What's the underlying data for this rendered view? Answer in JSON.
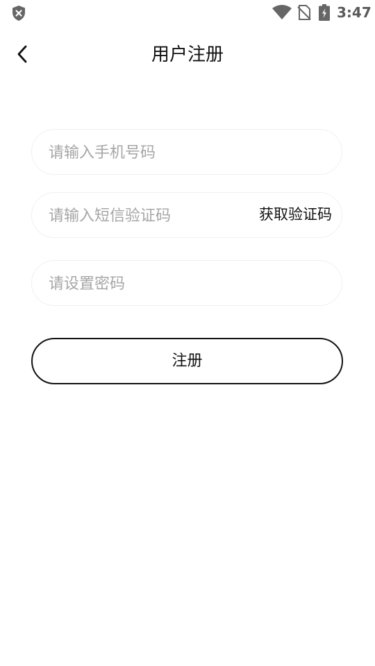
{
  "status_bar": {
    "time": "3:47",
    "icons": [
      "shield-x-icon",
      "wifi-icon",
      "no-sim-icon",
      "battery-charging-icon"
    ]
  },
  "header": {
    "back_icon": "chevron-left-icon",
    "title": "用户注册"
  },
  "form": {
    "phone": {
      "placeholder": "请输入手机号码",
      "value": ""
    },
    "sms_code": {
      "placeholder": "请输入短信验证码",
      "value": "",
      "get_code_label": "获取验证码"
    },
    "password": {
      "placeholder": "请设置密码",
      "value": ""
    },
    "submit_label": "注册"
  }
}
